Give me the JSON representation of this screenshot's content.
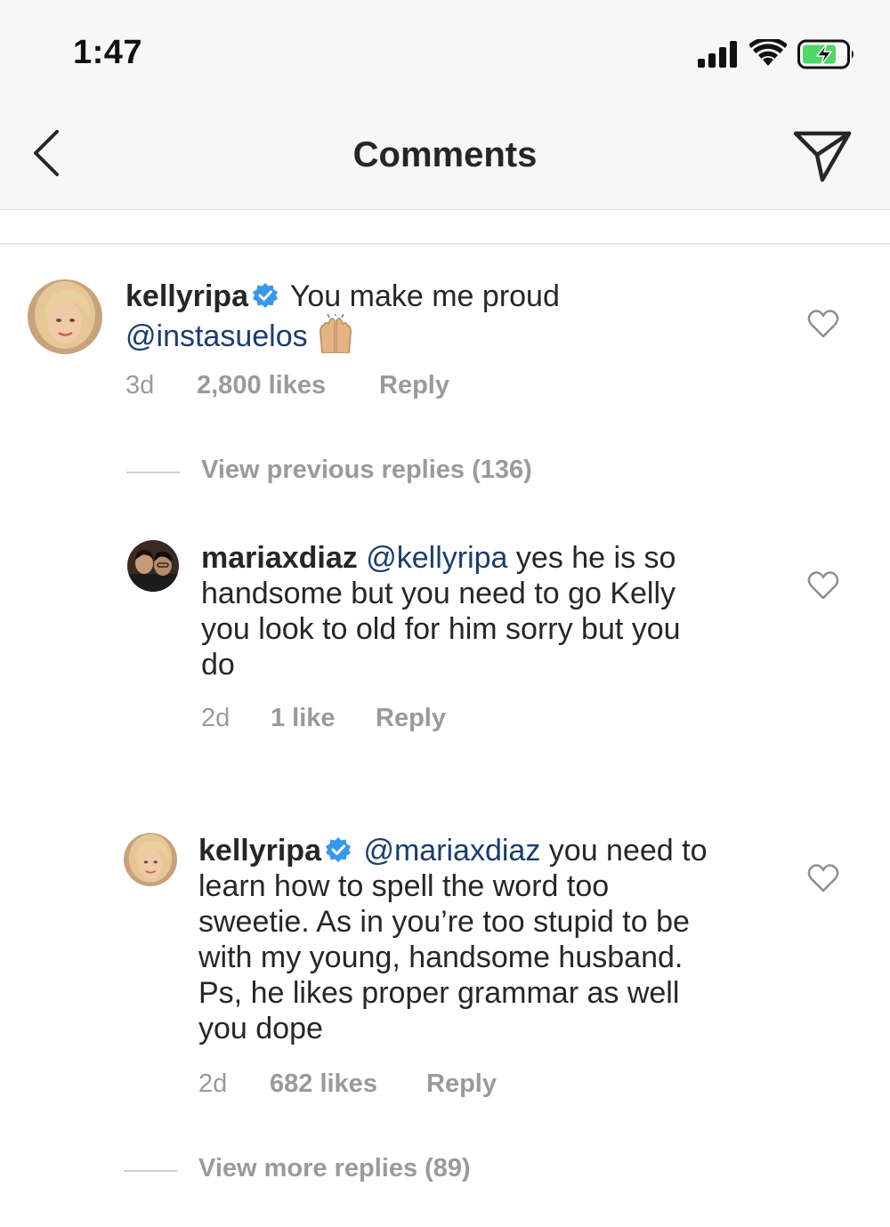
{
  "status_bar": {
    "time": "1:47",
    "icons": [
      "signal-icon",
      "wifi-icon",
      "battery-charging-icon"
    ],
    "battery_color": "#4cd964"
  },
  "header": {
    "title": "Comments",
    "back_icon": "chevron-left-icon",
    "share_icon": "paper-plane-icon"
  },
  "colors": {
    "mention": "#1a3d6e",
    "meta": "#9a9a9a",
    "verified": "#3897f0"
  },
  "comments": [
    {
      "username": "kellyripa",
      "verified": true,
      "text_lead": "You make me proud",
      "mention": "@instasuelos",
      "emoji": "raising-hands-emoji",
      "age": "3d",
      "likes": "2,800 likes",
      "reply": "Reply"
    }
  ],
  "view_previous": "View previous replies (136)",
  "replies": [
    {
      "username": "mariaxdiaz",
      "verified": false,
      "mention": "@kellyripa",
      "line1_rest": "yes he is so",
      "line2": "handsome but you need to go Kelly",
      "line3": "you look to old for him sorry but you",
      "line4": "do",
      "age": "2d",
      "likes": "1 like",
      "reply": "Reply"
    },
    {
      "username": "kellyripa",
      "verified": true,
      "mention": "@mariaxdiaz",
      "line1_rest": "you need to",
      "line2": "learn how to spell the word too",
      "line3": "sweetie. As in you’re too stupid to be",
      "line4": "with my young, handsome husband.",
      "line5": "Ps, he likes proper grammar as well",
      "line6": "you dope",
      "age": "2d",
      "likes": "682 likes",
      "reply": "Reply"
    }
  ],
  "view_more": "View more replies (89)"
}
